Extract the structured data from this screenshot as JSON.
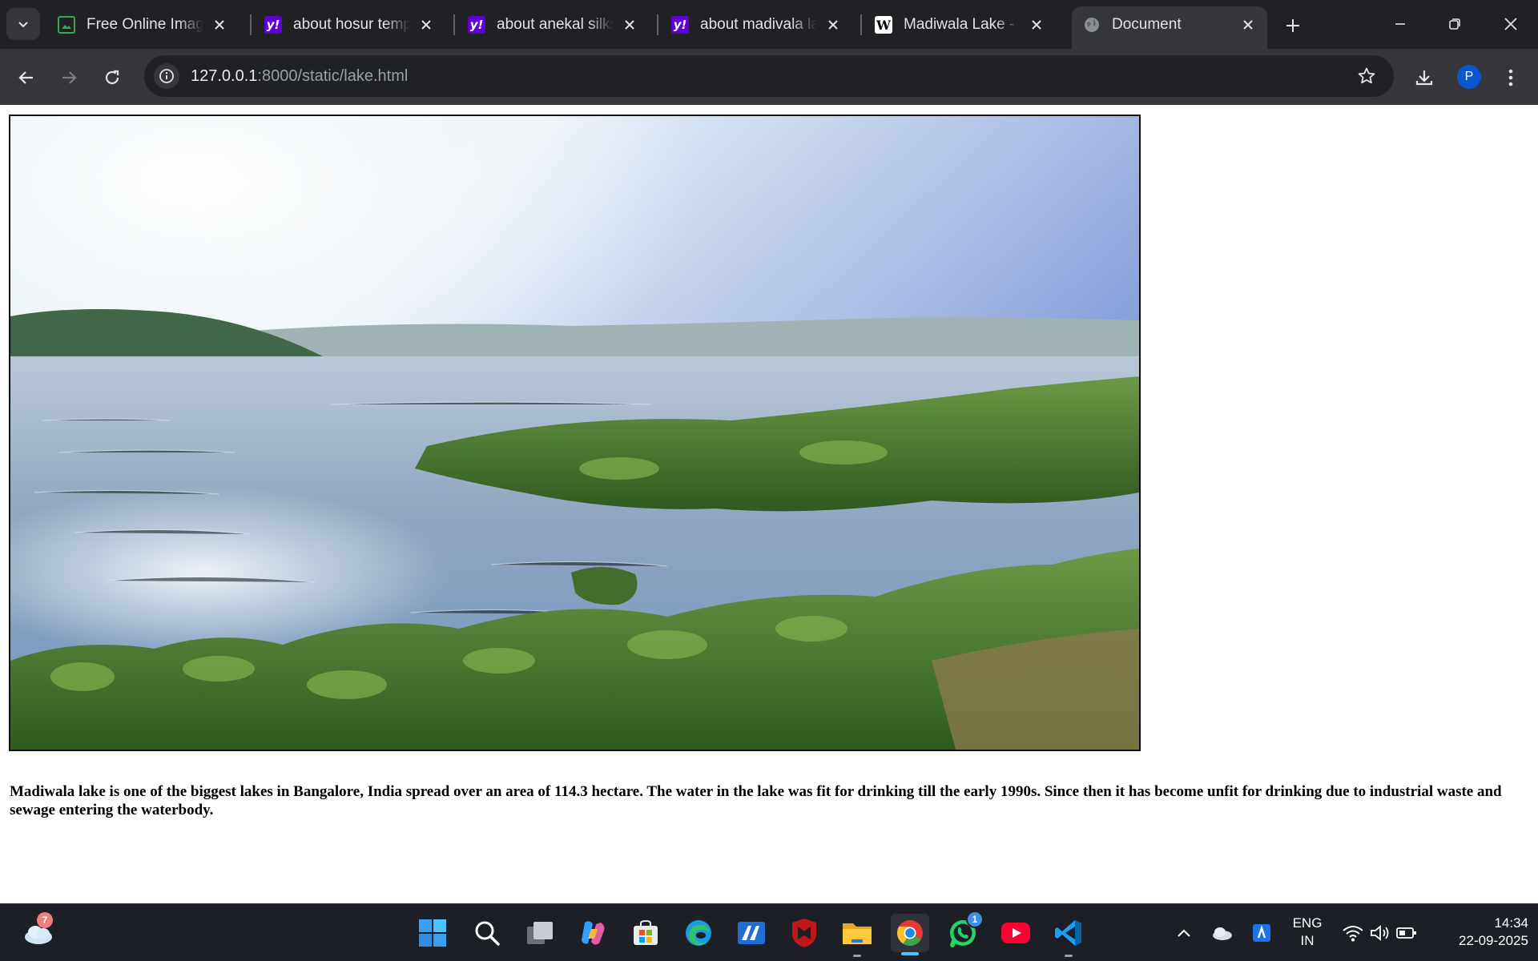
{
  "browser": {
    "tabs": [
      {
        "title": "Free Online Image",
        "favicon": "image-editor-icon",
        "active": false
      },
      {
        "title": "about hosur templ",
        "favicon": "yahoo-icon",
        "active": false
      },
      {
        "title": "about anekal silks",
        "favicon": "yahoo-icon",
        "active": false
      },
      {
        "title": "about madivala lak",
        "favicon": "yahoo-icon",
        "active": false
      },
      {
        "title": "Madiwala Lake - W",
        "favicon": "wikipedia-icon",
        "active": false
      },
      {
        "title": "Document",
        "favicon": "globe-icon",
        "active": true
      }
    ],
    "address": {
      "host": "127.0.0.1",
      "path": ":8000/static/lake.html"
    },
    "profile_initial": "P",
    "colors": {
      "frame": "#202124",
      "toolbar": "#35363a",
      "profile": "#0b57d0"
    }
  },
  "page": {
    "image_subject": "Madiwala lake with water hyacinth in foreground",
    "description": "Madiwala lake is one of the biggest lakes in Bangalore, India spread over an area of 114.3 hectare. The water in the lake was fit for drinking till the early 1990s. Since then it has become unfit for drinking due to industrial waste and sewage entering the waterbody."
  },
  "taskbar": {
    "weather_badge": "7",
    "whatsapp_badge": "1",
    "language_top": "ENG",
    "language_bottom": "IN",
    "time": "14:34",
    "date": "22-09-2025",
    "pinned": [
      "start-icon",
      "search-icon",
      "task-view-icon",
      "copilot-icon",
      "store-icon",
      "edge-icon",
      "anydesk-icon",
      "mcafee-icon",
      "file-explorer-icon",
      "chrome-icon",
      "whatsapp-icon",
      "youtube-icon",
      "vscode-icon"
    ]
  }
}
